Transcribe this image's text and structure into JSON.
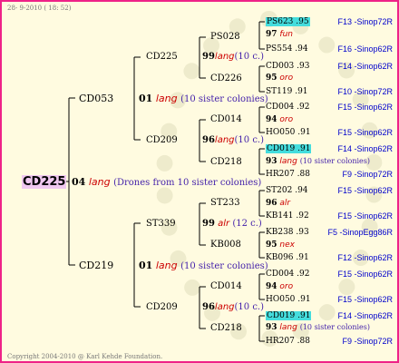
{
  "header": "28- 9-2010 ( 18: 52)",
  "footer": "Copyright 2004-2010 @ Karl Kehde Foundation.",
  "root": {
    "id": "CD225",
    "year": "04",
    "queen": "lang",
    "note": "(Drones from 10 sister colonies)"
  },
  "gen1": [
    {
      "id": "CD053",
      "year": "01",
      "queen": "lang",
      "note": "(10 sister colonies)"
    },
    {
      "id": "CD219",
      "year": "01",
      "queen": "lang",
      "note": "(10 sister colonies)"
    }
  ],
  "gen2": [
    {
      "id": "CD225",
      "year": "99",
      "queen": "lang",
      "note": "(10 c.)"
    },
    {
      "id": "CD209",
      "year": "96",
      "queen": "lang",
      "note": "(10 c.)"
    },
    {
      "id": "ST339",
      "year": "99",
      "queen": "alr",
      "note": "(12 c.)"
    },
    {
      "id": "CD209",
      "year": "96",
      "queen": "lang",
      "note": "(10 c.)"
    }
  ],
  "gen3": [
    {
      "id": "PS028",
      "year": "97",
      "queen": "fun",
      "note": ""
    },
    {
      "id": "CD226",
      "year": "95",
      "queen": "oro",
      "note": ""
    },
    {
      "id": "CD014",
      "year": "94",
      "queen": "oro",
      "note": ""
    },
    {
      "id": "CD218",
      "year": "93",
      "queen": "lang",
      "note": "(10 sister colonies)"
    },
    {
      "id": "ST233",
      "year": "96",
      "queen": "alr",
      "note": ""
    },
    {
      "id": "KB008",
      "year": "95",
      "queen": "nex",
      "note": ""
    },
    {
      "id": "CD014",
      "year": "94",
      "queen": "oro",
      "note": ""
    },
    {
      "id": "CD218",
      "year": "93",
      "queen": "lang",
      "note": "(10 sister colonies)"
    }
  ],
  "gen4": [
    {
      "id": "PS623 .95",
      "loc": "F13 -Sinop72R"
    },
    {
      "id": "PS554 .94",
      "loc": "F16 -Sinop62R"
    },
    {
      "id": "CD003 .93",
      "loc": "F14 -Sinop62R"
    },
    {
      "id": "ST119 .91",
      "loc": "F10 -Sinop72R"
    },
    {
      "id": "CD004 .92",
      "loc": "F15 -Sinop62R"
    },
    {
      "id": "HO050 .91",
      "loc": "F15 -Sinop62R"
    },
    {
      "id": "CD019 .91",
      "loc": "F14 -Sinop62R"
    },
    {
      "id": "HR207 .88",
      "loc": "F9 -Sinop72R"
    },
    {
      "id": "ST202 .94",
      "loc": "F15 -Sinop62R"
    },
    {
      "id": "KB141 .92",
      "loc": "F15 -Sinop62R"
    },
    {
      "id": "KB238 .93",
      "loc": "F5 -SinopEgg86R"
    },
    {
      "id": "KB096 .91",
      "loc": "F12 -Sinop62R"
    },
    {
      "id": "CD004 .92",
      "loc": "F15 -Sinop62R"
    },
    {
      "id": "HO050 .91",
      "loc": "F15 -Sinop62R"
    },
    {
      "id": "CD019 .91",
      "loc": "F14 -Sinop62R"
    },
    {
      "id": "HR207 .88",
      "loc": "F9 -Sinop72R"
    }
  ]
}
